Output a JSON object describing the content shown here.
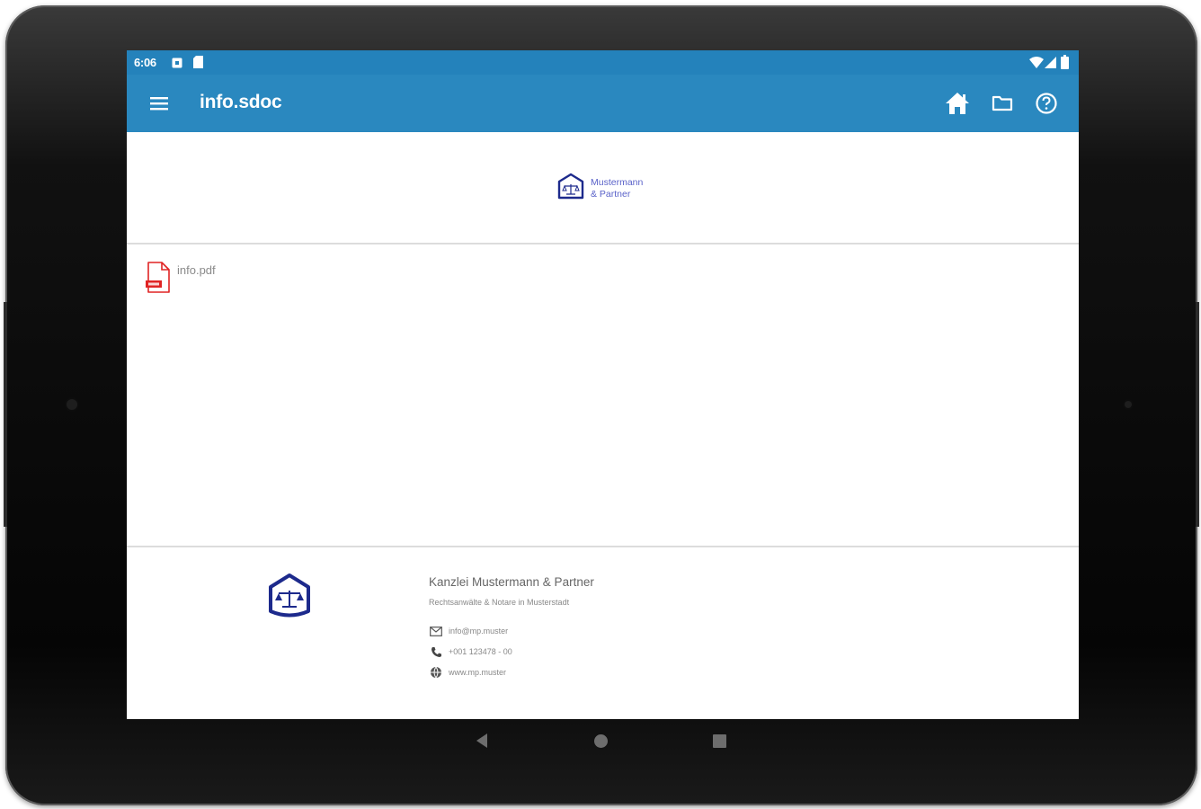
{
  "status_bar": {
    "time": "6:06",
    "left_icons": [
      "notification-square-icon",
      "sd-card-icon"
    ],
    "right_icons": [
      "wifi-icon",
      "signal-icon",
      "battery-icon"
    ]
  },
  "app_bar": {
    "title": "info.sdoc",
    "menu_icon": "menu-icon",
    "actions": [
      "home-icon",
      "folder-icon",
      "help-icon"
    ]
  },
  "header_logo": {
    "line1": "Mustermann",
    "line2": "& Partner"
  },
  "files": [
    {
      "name": "info.pdf",
      "icon": "pdf-file-icon"
    }
  ],
  "footer": {
    "company": "Kanzlei Mustermann & Partner",
    "subtitle": "Rechtsanwälte & Notare in Musterstadt",
    "email": "info@mp.muster",
    "phone": "+001 123478 - 00",
    "website": "www.mp.muster"
  },
  "colors": {
    "status_bar": "#2482bb",
    "app_bar": "#2a88bf",
    "logo_blue": "#1d2a8c",
    "pdf_red": "#e02424"
  },
  "nav_bar": [
    "back-icon",
    "home-circle-icon",
    "recents-icon"
  ]
}
